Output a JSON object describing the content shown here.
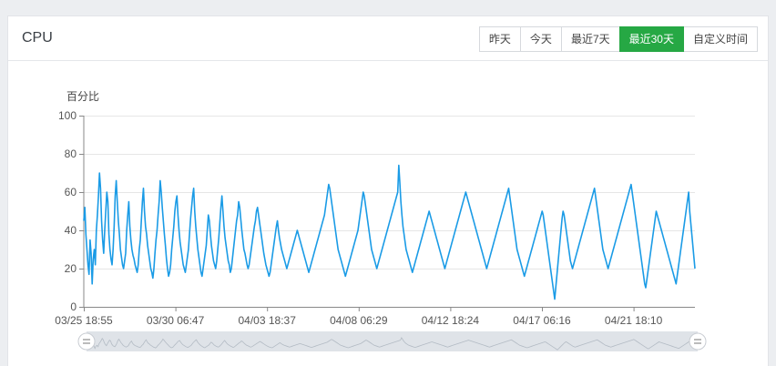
{
  "panel": {
    "title": "CPU",
    "range_buttons": [
      {
        "label": "昨天",
        "active": false
      },
      {
        "label": "今天",
        "active": false
      },
      {
        "label": "最近7天",
        "active": false
      },
      {
        "label": "最近30天",
        "active": true
      },
      {
        "label": "自定义时间",
        "active": false
      }
    ]
  },
  "colors": {
    "accent": "#26a844",
    "series": "#1a9be6",
    "grid": "#e6e6e6",
    "slider_bg": "#dfe3e8",
    "slider_line": "#b3bbc4"
  },
  "chart_data": {
    "type": "line",
    "ylabel": "百分比",
    "ylim": [
      0,
      100
    ],
    "yticks": [
      0,
      20,
      40,
      60,
      80,
      100
    ],
    "xticks": [
      "03/25 18:55",
      "03/30 06:47",
      "04/03 18:37",
      "04/08 06:29",
      "04/12 18:24",
      "04/17 06:16",
      "04/21 18:10"
    ],
    "grid": true,
    "has_datazoom_slider": true,
    "series": [
      {
        "values": [
          45,
          52,
          38,
          30,
          22,
          17,
          35,
          28,
          12,
          25,
          30,
          22,
          40,
          48,
          58,
          70,
          62,
          45,
          35,
          28,
          40,
          50,
          60,
          55,
          38,
          30,
          25,
          22,
          30,
          42,
          58,
          66,
          55,
          45,
          38,
          30,
          26,
          22,
          20,
          24,
          28,
          40,
          48,
          55,
          42,
          35,
          30,
          27,
          25,
          22,
          20,
          18,
          22,
          30,
          35,
          45,
          55,
          62,
          50,
          42,
          38,
          32,
          28,
          24,
          20,
          18,
          15,
          20,
          28,
          35,
          40,
          48,
          55,
          66,
          60,
          52,
          45,
          38,
          32,
          25,
          20,
          16,
          18,
          22,
          30,
          36,
          42,
          50,
          55,
          58,
          48,
          40,
          34,
          30,
          26,
          22,
          20,
          18,
          22,
          26,
          30,
          38,
          46,
          52,
          58,
          62,
          50,
          42,
          36,
          30,
          26,
          22,
          18,
          16,
          20,
          24,
          28,
          32,
          40,
          48,
          45,
          38,
          32,
          28,
          24,
          22,
          20,
          24,
          30,
          36,
          44,
          52,
          58,
          50,
          42,
          36,
          32,
          28,
          24,
          22,
          18,
          20,
          25,
          30,
          35,
          40,
          45,
          48,
          55,
          52,
          46,
          40,
          35,
          30,
          28,
          25,
          22,
          20,
          22,
          26,
          30,
          34,
          38,
          42,
          45,
          50,
          52,
          48,
          44,
          40,
          36,
          32,
          28,
          25,
          22,
          20,
          18,
          16,
          18,
          22,
          26,
          30,
          34,
          38,
          42,
          45,
          40,
          36,
          33,
          30,
          28,
          26,
          24,
          22,
          20,
          22,
          24,
          26,
          28,
          30,
          32,
          34,
          36,
          38,
          40,
          38,
          36,
          34,
          32,
          30,
          28,
          26,
          24,
          22,
          20,
          18,
          20,
          22,
          24,
          26,
          28,
          30,
          32,
          34,
          36,
          38,
          40,
          42,
          44,
          46,
          48,
          52,
          56,
          60,
          64,
          62,
          58,
          54,
          50,
          46,
          42,
          38,
          34,
          30,
          28,
          26,
          24,
          22,
          20,
          18,
          16,
          18,
          20,
          22,
          24,
          26,
          28,
          30,
          32,
          34,
          36,
          38,
          40,
          44,
          48,
          52,
          56,
          60,
          58,
          54,
          50,
          46,
          42,
          38,
          34,
          30,
          28,
          26,
          24,
          22,
          20,
          22,
          24,
          26,
          28,
          30,
          32,
          34,
          36,
          38,
          40,
          42,
          44,
          46,
          48,
          50,
          52,
          54,
          56,
          58,
          60,
          74,
          65,
          55,
          48,
          42,
          38,
          34,
          30,
          28,
          26,
          24,
          22,
          20,
          18,
          20,
          22,
          24,
          26,
          28,
          30,
          32,
          34,
          36,
          38,
          40,
          42,
          44,
          46,
          48,
          50,
          48,
          46,
          44,
          42,
          40,
          38,
          36,
          34,
          32,
          30,
          28,
          26,
          24,
          22,
          20,
          22,
          24,
          26,
          28,
          30,
          32,
          34,
          36,
          38,
          40,
          42,
          44,
          46,
          48,
          50,
          52,
          54,
          56,
          58,
          60,
          58,
          56,
          54,
          52,
          50,
          48,
          46,
          44,
          42,
          40,
          38,
          36,
          34,
          32,
          30,
          28,
          26,
          24,
          22,
          20,
          22,
          24,
          26,
          28,
          30,
          32,
          34,
          36,
          38,
          40,
          42,
          44,
          46,
          48,
          50,
          52,
          54,
          56,
          58,
          60,
          62,
          58,
          54,
          50,
          46,
          42,
          38,
          34,
          30,
          28,
          26,
          24,
          22,
          20,
          18,
          16,
          18,
          20,
          22,
          24,
          26,
          28,
          30,
          32,
          34,
          36,
          38,
          40,
          42,
          44,
          46,
          48,
          50,
          48,
          44,
          40,
          36,
          32,
          28,
          24,
          20,
          16,
          12,
          8,
          4,
          10,
          16,
          22,
          28,
          34,
          40,
          46,
          50,
          48,
          44,
          40,
          36,
          32,
          28,
          24,
          22,
          20,
          22,
          24,
          26,
          28,
          30,
          32,
          34,
          36,
          38,
          40,
          42,
          44,
          46,
          48,
          50,
          52,
          54,
          56,
          58,
          60,
          62,
          58,
          54,
          50,
          46,
          42,
          38,
          34,
          30,
          28,
          26,
          24,
          22,
          20,
          22,
          24,
          26,
          28,
          30,
          32,
          34,
          36,
          38,
          40,
          42,
          44,
          46,
          48,
          50,
          52,
          54,
          56,
          58,
          60,
          62,
          64,
          60,
          56,
          52,
          48,
          44,
          40,
          36,
          32,
          28,
          24,
          20,
          16,
          12,
          10,
          14,
          18,
          22,
          26,
          30,
          34,
          38,
          42,
          46,
          50,
          48,
          46,
          44,
          42,
          40,
          38,
          36,
          34,
          32,
          30,
          28,
          26,
          24,
          22,
          20,
          18,
          16,
          14,
          12,
          16,
          20,
          24,
          28,
          32,
          36,
          40,
          44,
          48,
          52,
          56,
          60,
          50,
          44,
          38,
          32,
          26,
          20
        ]
      }
    ]
  }
}
